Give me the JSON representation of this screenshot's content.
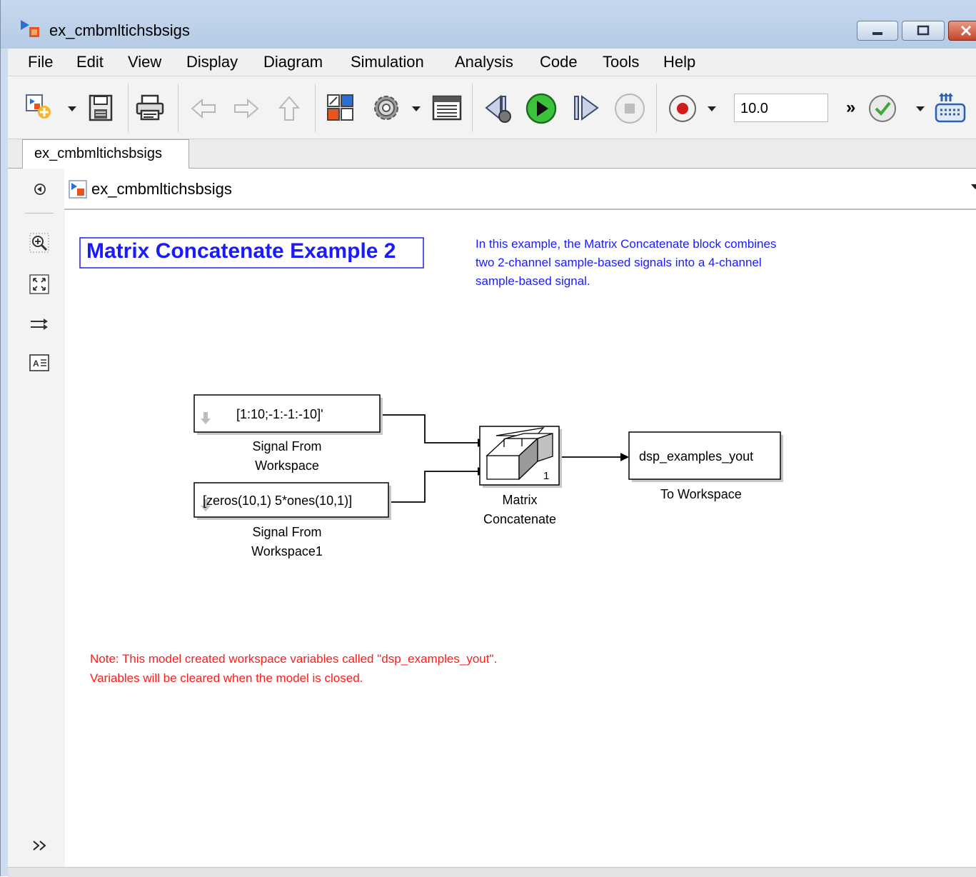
{
  "window": {
    "title": "ex_cmbmltichsbsigs"
  },
  "menu": [
    "File",
    "Edit",
    "View",
    "Display",
    "Diagram",
    "Simulation",
    "Analysis",
    "Code",
    "Tools",
    "Help"
  ],
  "toolbar": {
    "stop_time": "10.0",
    "overflow": "»"
  },
  "tab": {
    "label": "ex_cmbmltichsbsigs"
  },
  "address": {
    "path": "ex_cmbmltichsbsigs"
  },
  "model": {
    "title_annotation": "Matrix Concatenate Example 2",
    "description": [
      "In this example, the Matrix Concatenate block combines",
      "two 2-channel sample-based signals into a 4-channel",
      "sample-based signal."
    ],
    "note": [
      "Note: This model created workspace variables called \"dsp_examples_yout\".",
      "Variables will be cleared when the model is closed."
    ],
    "blocks": {
      "sfw1": {
        "value": "[1:10;-1:-1:-10]'",
        "name": [
          "Signal From",
          "Workspace"
        ]
      },
      "sfw2": {
        "value": "[zeros(10,1) 5*ones(10,1)]",
        "name": [
          "Signal From",
          "Workspace1"
        ]
      },
      "concat": {
        "port_label": "1",
        "name": [
          "Matrix",
          "Concatenate"
        ]
      },
      "tows": {
        "value": "dsp_examples_yout",
        "name": "To Workspace"
      }
    }
  },
  "colors": {
    "annotation_blue": "#1a1aff",
    "note_red": "#ff1a1a",
    "title_border": "#2020e0"
  }
}
